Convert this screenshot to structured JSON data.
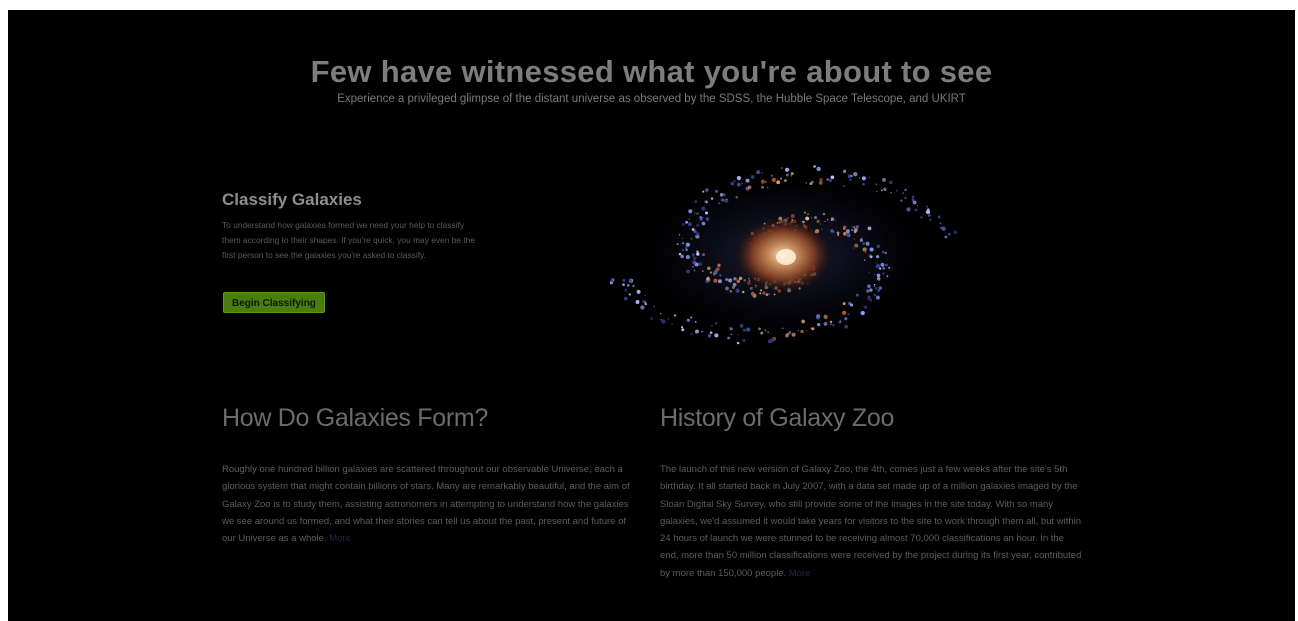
{
  "hero": {
    "title": "Few have witnessed what you're about to see",
    "subtitle": "Experience a privileged glimpse of the distant universe as observed by the SDSS, the Hubble Space Telescope, and UKIRT"
  },
  "classify": {
    "title": "Classify Galaxies",
    "text": "To understand how galaxies formed we need your help to classify them according to their shapes. If you're quick, you may even be the first person to see the galaxies you're asked to classify.",
    "button_label": "Begin Classifying"
  },
  "how_form": {
    "title": "How Do Galaxies Form?",
    "text": "Roughly one hundred billion galaxies are scattered throughout our observable Universe, each a glorious system that might contain billions of stars. Many are remarkably beautiful, and the aim of Galaxy Zoo is to study them, assisting astronomers in attempting to understand how the galaxies we see around us formed, and what their stories can tell us about the past, present and future of our Universe as a whole.",
    "link": "More"
  },
  "history": {
    "title": "History of Galaxy Zoo",
    "text": "The launch of this new version of Galaxy Zoo, the 4th, comes just a few weeks after the site's 5th birthday. It all started back in July 2007, with a data set made up of a million galaxies imaged by the Sloan Digital Sky Survey, who still provide some of the images in the site today. With so many galaxies, we'd assumed it would take years for visitors to the site to work through them all, but within 24 hours of launch we were stunned to be receiving almost 70,000 classifications an hour. In the end, more than 50 million classifications were received by the project during its first year, contributed by more than 150,000 people.",
    "link": "More"
  },
  "colors": {
    "background": "#000000",
    "button": "#4b7c0e"
  },
  "icons": {
    "galaxy_image": "spiral-galaxy-image"
  }
}
